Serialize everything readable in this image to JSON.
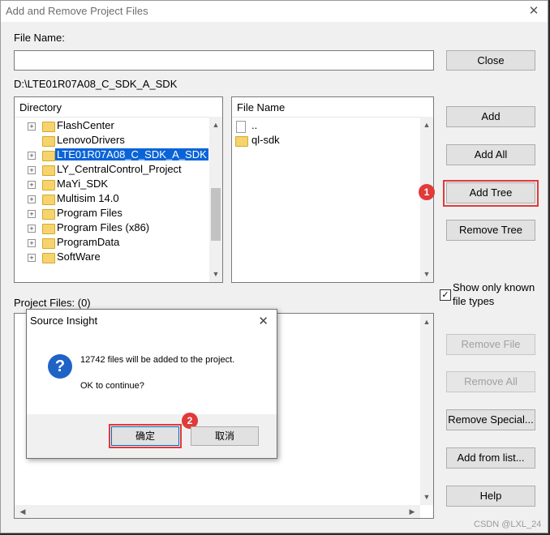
{
  "window": {
    "title": "Add and Remove Project Files",
    "close_glyph": "✕"
  },
  "file_name": {
    "label": "File Name:",
    "value": ""
  },
  "current_path": "D:\\LTE01R07A08_C_SDK_A_SDK",
  "directory": {
    "header": "Directory",
    "items": [
      {
        "label": "FlashCenter",
        "expandable": true,
        "selected": false
      },
      {
        "label": "LenovoDrivers",
        "expandable": false,
        "selected": false
      },
      {
        "label": "LTE01R07A08_C_SDK_A_SDK",
        "expandable": true,
        "selected": true
      },
      {
        "label": "LY_CentralControl_Project",
        "expandable": true,
        "selected": false
      },
      {
        "label": "MaYi_SDK",
        "expandable": true,
        "selected": false
      },
      {
        "label": "Multisim 14.0",
        "expandable": true,
        "selected": false
      },
      {
        "label": "Program Files",
        "expandable": true,
        "selected": false
      },
      {
        "label": "Program Files (x86)",
        "expandable": true,
        "selected": false
      },
      {
        "label": "ProgramData",
        "expandable": true,
        "selected": false
      },
      {
        "label": "SoftWare",
        "expandable": true,
        "selected": false
      }
    ]
  },
  "file_list": {
    "header": "File Name",
    "items": [
      {
        "label": "..",
        "kind": "file"
      },
      {
        "label": "ql-sdk",
        "kind": "folder"
      }
    ]
  },
  "buttons": {
    "close": "Close",
    "add": "Add",
    "add_all": "Add All",
    "add_tree": "Add Tree",
    "remove_tree": "Remove Tree",
    "remove_file": "Remove File",
    "remove_all": "Remove All",
    "remove_special": "Remove Special...",
    "add_from_list": "Add from list...",
    "help": "Help"
  },
  "show_known_types": {
    "label_line1": "Show only known",
    "label_line2": "file types",
    "checked": true,
    "check_glyph": "✓"
  },
  "project_files": {
    "label": "Project Files: (0)"
  },
  "dialog": {
    "title": "Source Insight",
    "icon_glyph": "?",
    "message": "12742 files will be added to the project.",
    "question": "OK to continue?",
    "ok": "确定",
    "cancel": "取消",
    "close_glyph": "✕"
  },
  "badges": {
    "first": "1",
    "second": "2"
  },
  "accent_colors": {
    "highlight": "#e03a3a",
    "selection": "#0a64d8"
  },
  "watermark": "CSDN @LXL_24"
}
